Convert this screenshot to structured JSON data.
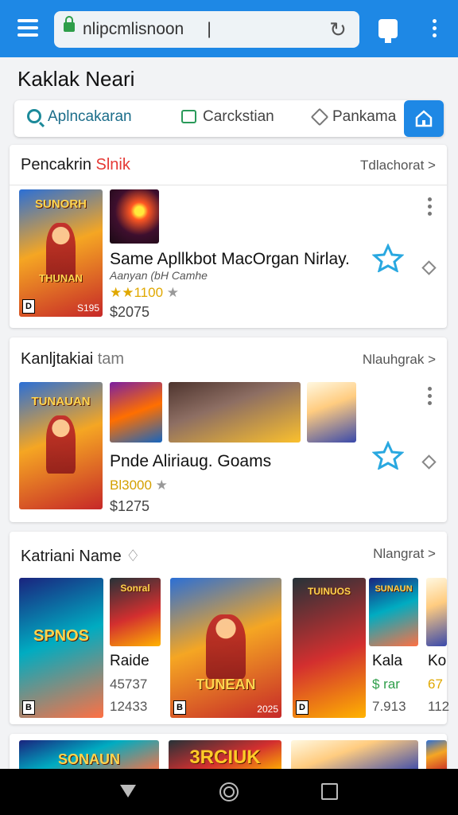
{
  "browser": {
    "url": "nlipcmlisnoon",
    "cursor": "|"
  },
  "header": {
    "title": "Kaklak Neari"
  },
  "tabs": [
    {
      "label": "Aplncakaran",
      "icon": "search-icon"
    },
    {
      "label": "Carckstian",
      "icon": "chat-icon"
    },
    {
      "label": "Pankama",
      "icon": "tag-icon"
    }
  ],
  "section1": {
    "title": "Pencakrin",
    "title_accent": "Slnik",
    "more": "Tdlachorat >",
    "poster_title": "SUNORH",
    "poster_title2": "THUNAN",
    "poster_price": "S195",
    "poster_badge": "D",
    "app_title": "Same Apllkbot MacOrgan Nirlay.",
    "app_sub": "Aanyan (bH Camhe",
    "rating": "★★1100",
    "rating_star": "★",
    "price": "$2075"
  },
  "section2": {
    "title": "Kanljtakiai",
    "title_muted": "tam",
    "more": "Nlauhgrak >",
    "poster_title": "TUNAUAN",
    "app_title": "Pnde  Aliriaug. Goams",
    "rating": "Bl3000",
    "rating_star": "★",
    "price": "$1275"
  },
  "section3": {
    "title": "Katriani Name",
    "title_suffix": "♢",
    "more": "Nlangrat >",
    "tiles": [
      {
        "poster_title": "SPNOS",
        "badge": "B"
      },
      {
        "poster_title": "Sonral",
        "name": "Raide",
        "a": "45737",
        "b": "12433"
      },
      {
        "poster_title": "TUNEAN",
        "badge": "B",
        "price": "2025"
      },
      {
        "poster_title": "TUINUOS",
        "badge": "D"
      },
      {
        "poster_title": "SUNAUN",
        "name": "Kala",
        "a": "$ rar",
        "b": "7.913"
      },
      {
        "name": "Ko",
        "a": "67",
        "b": "112"
      }
    ]
  },
  "section4": {
    "poster_title": "SONAUN",
    "poster_title2": "3RCIUK"
  }
}
